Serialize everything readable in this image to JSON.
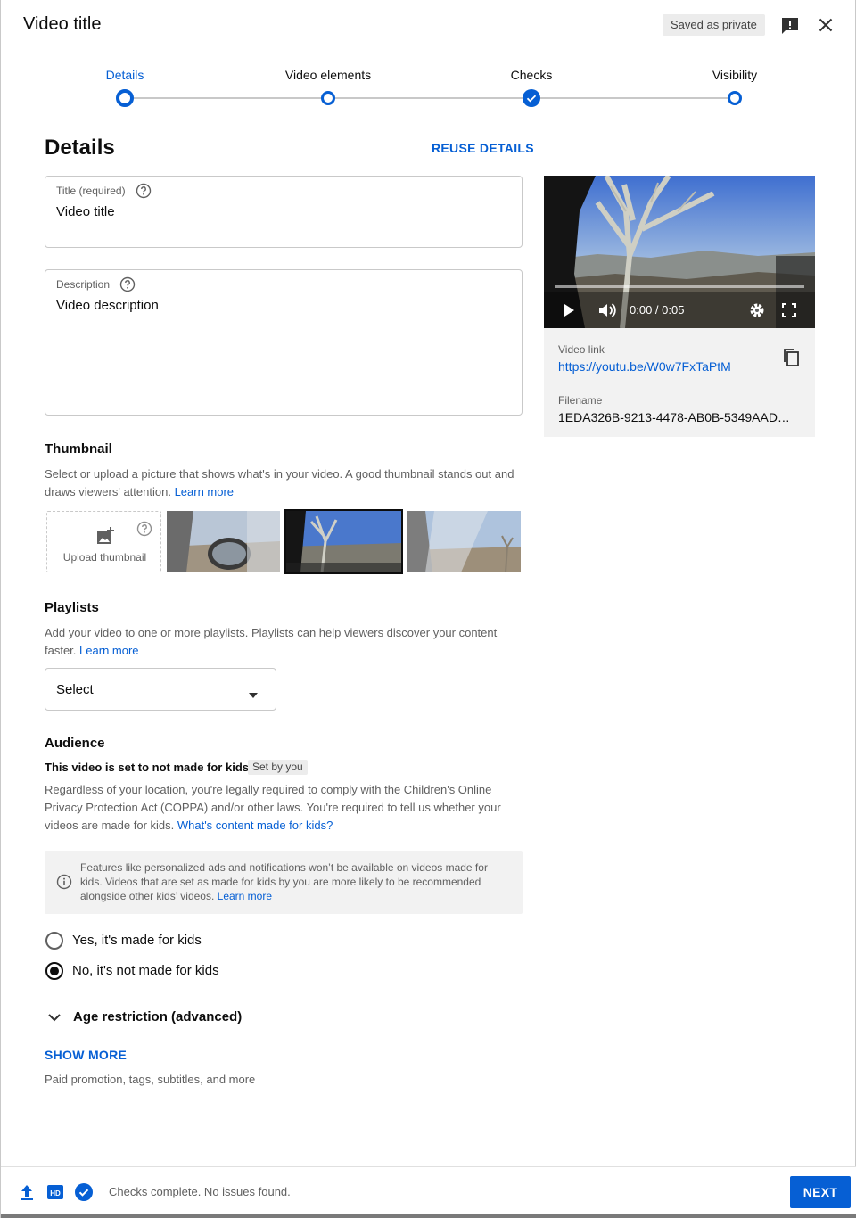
{
  "header": {
    "title": "Video title",
    "saved_badge": "Saved as private"
  },
  "stepper": {
    "steps": [
      {
        "label": "Details",
        "state": "active"
      },
      {
        "label": "Video elements",
        "state": "pending"
      },
      {
        "label": "Checks",
        "state": "done"
      },
      {
        "label": "Visibility",
        "state": "pending"
      }
    ]
  },
  "details": {
    "heading": "Details",
    "reuse_label": "REUSE DETAILS",
    "title_field": {
      "label": "Title (required)",
      "value": "Video title"
    },
    "description_field": {
      "label": "Description",
      "value": "Video description"
    }
  },
  "preview": {
    "time": "0:00 / 0:05",
    "video_link_label": "Video link",
    "video_link": "https://youtu.be/W0w7FxTaPtM",
    "filename_label": "Filename",
    "filename": "1EDA326B-9213-4478-AB0B-5349AAD…"
  },
  "thumbnail": {
    "heading": "Thumbnail",
    "text": "Select or upload a picture that shows what's in your video. A good thumbnail stands out and draws viewers' attention.",
    "learn_more": "Learn more",
    "upload_label": "Upload thumbnail"
  },
  "playlists": {
    "heading": "Playlists",
    "text": "Add your video to one or more playlists. Playlists can help viewers discover your content faster.",
    "learn_more": "Learn more",
    "select_value": "Select"
  },
  "audience": {
    "heading": "Audience",
    "status": "This video is set to not made for kids",
    "set_by": "Set by you",
    "text": "Regardless of your location, you're legally required to comply with the Children's Online Privacy Protection Act (COPPA) and/or other laws. You're required to tell us whether your videos are made for kids.",
    "kids_link": "What's content made for kids?",
    "info": "Features like personalized ads and notifications won’t be available on videos made for kids. Videos that are set as made for kids by you are more likely to be recommended alongside other kids’ videos.",
    "info_link": "Learn more",
    "option_yes": "Yes, it's made for kids",
    "option_no": "No, it's not made for kids",
    "selected": "no"
  },
  "age_restriction": {
    "label": "Age restriction (advanced)"
  },
  "show_more": {
    "label": "SHOW MORE",
    "sub": "Paid promotion, tags, subtitles, and more"
  },
  "footer": {
    "status": "Checks complete. No issues found.",
    "next_label": "NEXT",
    "hd_label": "HD"
  },
  "colors": {
    "accent": "#065fd4",
    "text": "#0d0d0d",
    "secondary": "#606060"
  }
}
